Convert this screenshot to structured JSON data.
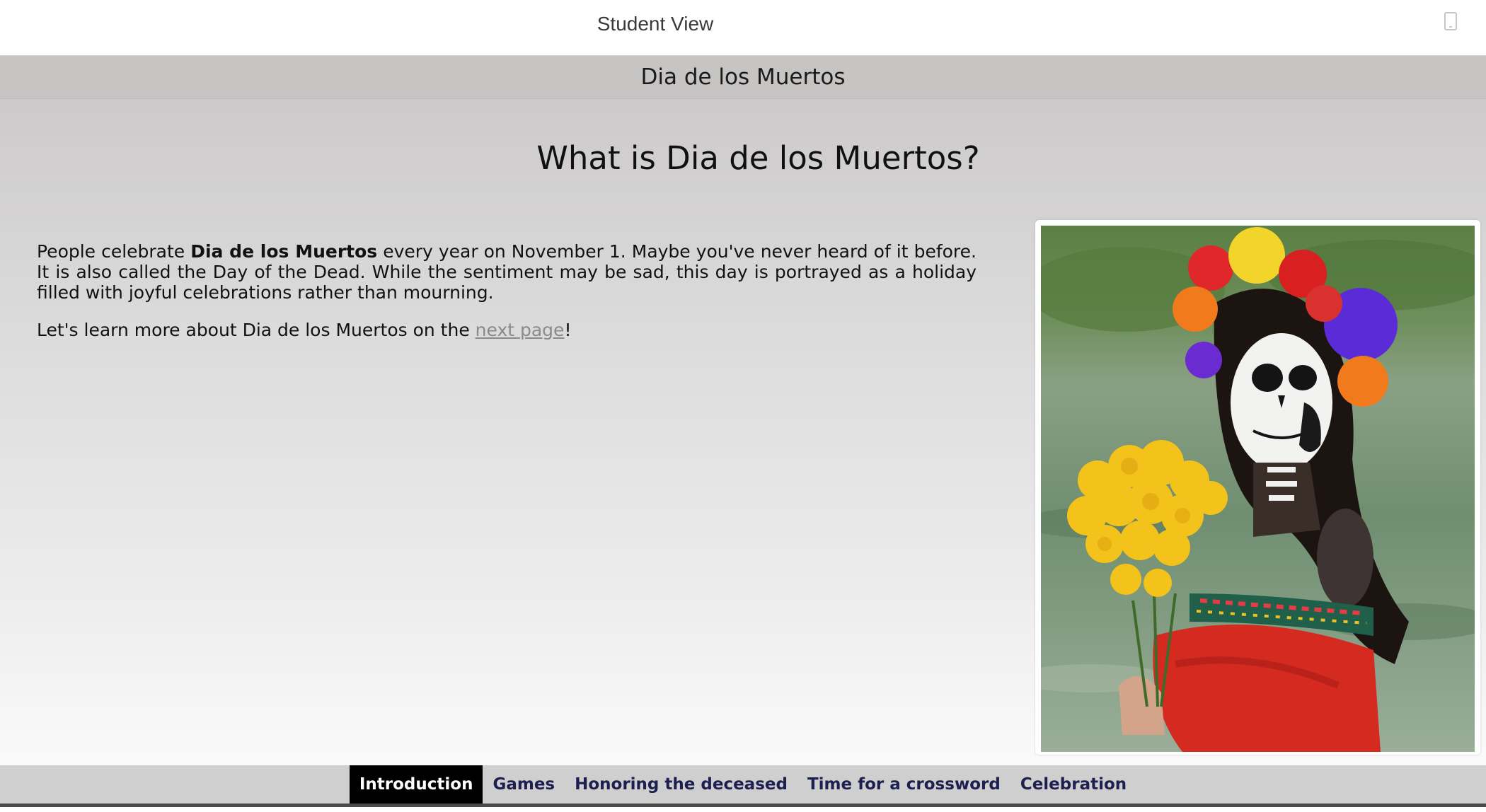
{
  "topbar": {
    "title": "Student View",
    "device_icon": "mobile-device-icon"
  },
  "lesson": {
    "title": "Dia de los Muertos"
  },
  "main": {
    "heading": "What is Dia de los Muertos?",
    "p1_before": "People celebrate ",
    "p1_bold": "Dia de los Muertos",
    "p1_after": " every year on November 1. Maybe you've never heard of it before. It is also called the Day of the Dead. While the sentiment may be sad, this day is portrayed as a holiday filled with joyful celebrations rather than mourning.",
    "p2_before": "Let's learn more about Dia de los Muertos on the ",
    "p2_link": "next page",
    "p2_after": "!"
  },
  "image": {
    "alt": "Woman with Catrina skull face paint holding marigolds"
  },
  "tabs": {
    "active": "Introduction",
    "items": [
      {
        "label": "Introduction"
      },
      {
        "label": "Games"
      },
      {
        "label": "Honoring the deceased"
      },
      {
        "label": "Time for a crossword"
      },
      {
        "label": "Celebration"
      }
    ]
  },
  "colors": {
    "tab_text": "#1d1f4f",
    "active_tab_bg": "#000000",
    "link": "#8a8a8a"
  }
}
